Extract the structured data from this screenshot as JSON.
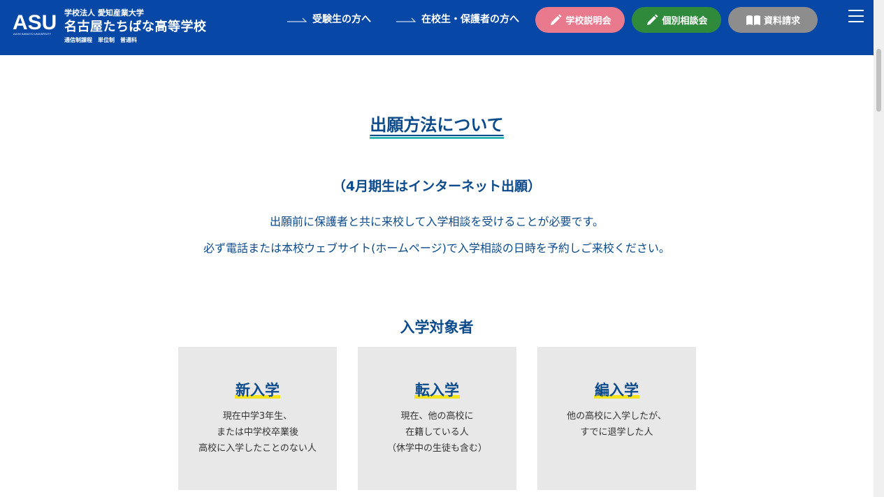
{
  "header": {
    "logo_text": "ASU",
    "logo_subtext": "AICHI SANGYO UNIVERSITY",
    "corp": "学校法人 愛知産業大学",
    "school_name": "名古屋たちばな高等学校",
    "course": [
      "通信制課程",
      "単位制",
      "普通科"
    ],
    "nav": [
      "受験生の方へ",
      "在校生・保護者の方へ"
    ],
    "buttons": {
      "briefing": "学校説明会",
      "consult": "個別相談会",
      "brochure": "資料請求"
    },
    "colors": {
      "header_bg": "#0747a6",
      "briefing": "#e97a8e",
      "consult": "#2f8a3c",
      "brochure": "#8d8d8d"
    }
  },
  "main": {
    "title": "出願方法について",
    "subheading": "（4月期生はインターネット出願）",
    "notes": [
      "出願前に保護者と共に来校して入学相談を受けることが必要です。",
      "必ず電話または本校ウェブサイト(ホームページ)で入学相談の日時を予約しご来校ください。"
    ],
    "targets_heading": "入学対象者",
    "cards": [
      {
        "title": "新入学",
        "lines": [
          "現在中学3年生、",
          "または中学校卒業後",
          "高校に入学したことのない人"
        ]
      },
      {
        "title": "転入学",
        "lines": [
          "現在、他の高校に",
          "在籍している人",
          "（休学中の生徒も含む）"
        ]
      },
      {
        "title": "編入学",
        "lines": [
          "他の高校に入学したが、",
          "すでに退学した人"
        ]
      }
    ]
  }
}
